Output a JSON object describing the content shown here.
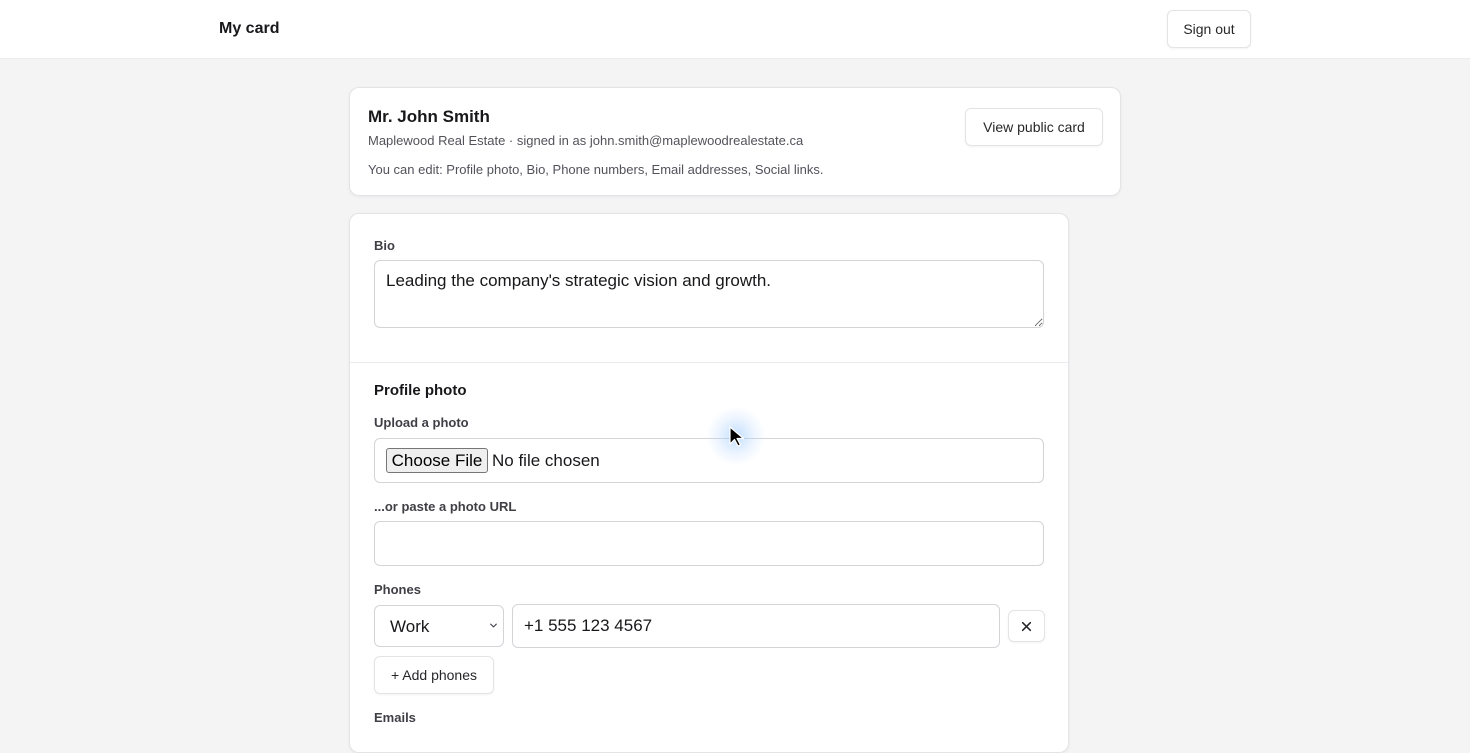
{
  "header": {
    "title": "My card",
    "sign_out_label": "Sign out"
  },
  "profile": {
    "name": "Mr. John Smith",
    "subtitle": "Maplewood Real Estate · signed in as john.smith@maplewoodrealestate.ca",
    "editable_note": "You can edit: Profile photo, Bio, Phone numbers, Email addresses, Social links.",
    "view_public_card_label": "View public card"
  },
  "bio": {
    "label": "Bio",
    "value": "Leading the company's strategic vision and growth."
  },
  "profile_photo": {
    "section_title": "Profile photo",
    "upload_label": "Upload a photo",
    "choose_file_label": "Choose File",
    "no_file_text": "No file chosen",
    "url_label": "...or paste a photo URL",
    "url_value": ""
  },
  "phones": {
    "label": "Phones",
    "items": [
      {
        "type": "Work",
        "number": "+1 555 123 4567"
      }
    ],
    "add_label": "+ Add phones"
  },
  "emails": {
    "label": "Emails"
  },
  "icons": {
    "remove": "close-icon",
    "select": "chevron-down-icon",
    "pointer": "mouse-cursor-icon"
  }
}
